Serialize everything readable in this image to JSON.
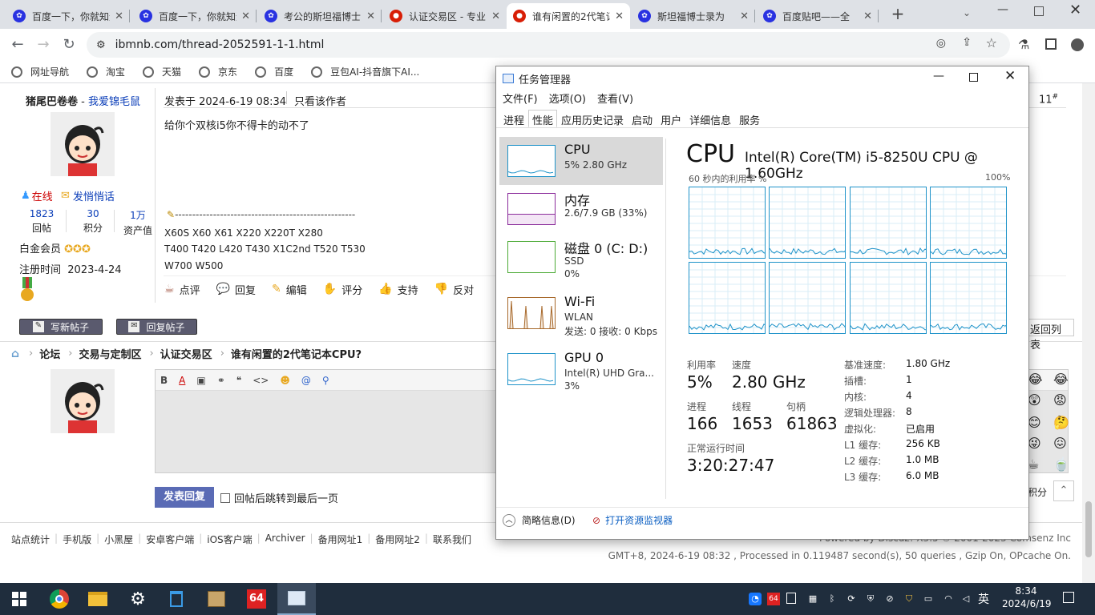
{
  "tabs": [
    {
      "title": "百度一下，你就知道",
      "icon": "baidu-paw-icon",
      "color": "#2932e1"
    },
    {
      "title": "百度一下，你就知道",
      "icon": "baidu-paw-icon",
      "color": "#2932e1"
    },
    {
      "title": "考公的斯坦福博士",
      "icon": "baidu-paw-icon",
      "color": "#2932e1"
    },
    {
      "title": "认证交易区 - 专业",
      "icon": "ibm-red-icon",
      "color": "#d81e06"
    },
    {
      "title": "谁有闲置的2代笔记",
      "icon": "ibm-red-icon",
      "color": "#d81e06"
    },
    {
      "title": "斯坦福博士录为",
      "icon": "baidu-paw-icon",
      "color": "#2932e1"
    },
    {
      "title": "百度贴吧——全",
      "icon": "baidu-paw-icon",
      "color": "#2932e1"
    }
  ],
  "toolbar": {
    "url": "ibmnb.com/thread-2052591-1-1.html"
  },
  "bookmarks": [
    "网址导航",
    "淘宝",
    "天猫",
    "京东",
    "百度",
    "豆包AI-抖音旗下AI..."
  ],
  "post": {
    "author": "猪尾巴卷卷",
    "author_sep": " - ",
    "author_title": "我爱锦毛鼠",
    "posted": "发表于 2024-6-19 08:34",
    "only_author": "只看该作者",
    "floor": "11",
    "floor_suffix": "#",
    "body": "给你个双核i5你不得卡的动不了",
    "sig_line": "----------------------------------------------------",
    "sig1": "X60S X60 X61 X220 X220T X280",
    "sig2": "T400 T420 L420 T430 X1C2nd T520 T530",
    "sig3": "W700  W500",
    "online": "在线",
    "message": "发悄悄话",
    "stats": [
      {
        "v": "1823",
        "k": "回帖"
      },
      {
        "v": "30",
        "k": "积分"
      },
      {
        "v": "1万",
        "k": "资产值"
      }
    ],
    "level": "白金会员",
    "reg_label": "注册时间",
    "reg_date": "2023-4-24",
    "actions": [
      "点评",
      "回复",
      "编辑",
      "评分",
      "支持",
      "反对"
    ]
  },
  "buttons": {
    "new_post": "写新帖子",
    "reply_post": "回复帖子",
    "back_list": "返回列表",
    "submit": "发表回复",
    "jump_last": "回帖后跳转到最后一页",
    "points": "积分"
  },
  "breadcrumb": [
    "论坛",
    "交易与定制区",
    "认证交易区",
    "谁有闲置的2代笔记本CPU?"
  ],
  "footer": {
    "links": [
      "站点统计",
      "手机版",
      "小黑屋",
      "安卓客户端",
      "iOS客户端",
      "Archiver",
      "备用网址1",
      "备用网址2",
      "联系我们"
    ],
    "powered": "Powered by Discuz! X3.5 © 2001-2023 Comsenz Inc",
    "processed": "GMT+8, 2024-6-19 08:32 , Processed in 0.119487 second(s), 50 queries , Gzip On, OPcache On."
  },
  "taskmgr": {
    "title": "任务管理器",
    "menu": [
      "文件(F)",
      "选项(O)",
      "查看(V)"
    ],
    "tabs": [
      "进程",
      "性能",
      "应用历史记录",
      "启动",
      "用户",
      "详细信息",
      "服务"
    ],
    "active_tab": 1,
    "sidebar": [
      {
        "name": "CPU",
        "sub1": "5% 2.80 GHz",
        "sub2": "",
        "color": "#1f93c9"
      },
      {
        "name": "内存",
        "sub1": "2.6/7.9 GB (33%)",
        "sub2": "",
        "color": "#8b2c9b",
        "fill": 0.33
      },
      {
        "name": "磁盘 0 (C: D:)",
        "sub1": "SSD",
        "sub2": "0%",
        "color": "#4caa36"
      },
      {
        "name": "Wi-Fi",
        "sub1": "WLAN",
        "sub2": "发送: 0 接收: 0 Kbps",
        "color": "#a7682a"
      },
      {
        "name": "GPU 0",
        "sub1": "Intel(R) UHD Gra...",
        "sub2": "3%",
        "color": "#1f93c9"
      }
    ],
    "cpu_title": "CPU",
    "cpu_model": "Intel(R) Core(TM) i5-8250U CPU @ 1.60GHz",
    "graph_label": "60 秒内的利用率 %",
    "graph_max": "100%",
    "stats": {
      "util_label": "利用率",
      "util": "5%",
      "speed_label": "速度",
      "speed": "2.80 GHz",
      "proc_label": "进程",
      "proc": "166",
      "thread_label": "线程",
      "thread": "1653",
      "handle_label": "句柄",
      "handle": "61863",
      "uptime_label": "正常运行时间",
      "uptime": "3:20:27:47"
    },
    "specs": [
      {
        "k": "基准速度:",
        "v": "1.80 GHz"
      },
      {
        "k": "插槽:",
        "v": "1"
      },
      {
        "k": "内核:",
        "v": "4"
      },
      {
        "k": "逻辑处理器:",
        "v": "8"
      },
      {
        "k": "虚拟化:",
        "v": "已启用"
      },
      {
        "k": "L1 缓存:",
        "v": "256 KB"
      },
      {
        "k": "L2 缓存:",
        "v": "1.0 MB"
      },
      {
        "k": "L3 缓存:",
        "v": "6.0 MB"
      }
    ],
    "footer_less": "简略信息(D)",
    "footer_monitor": "打开资源监视器"
  },
  "taskbar": {
    "time": "8:34",
    "date": "2024/6/19",
    "ime": "英",
    "app_badge": "64"
  }
}
